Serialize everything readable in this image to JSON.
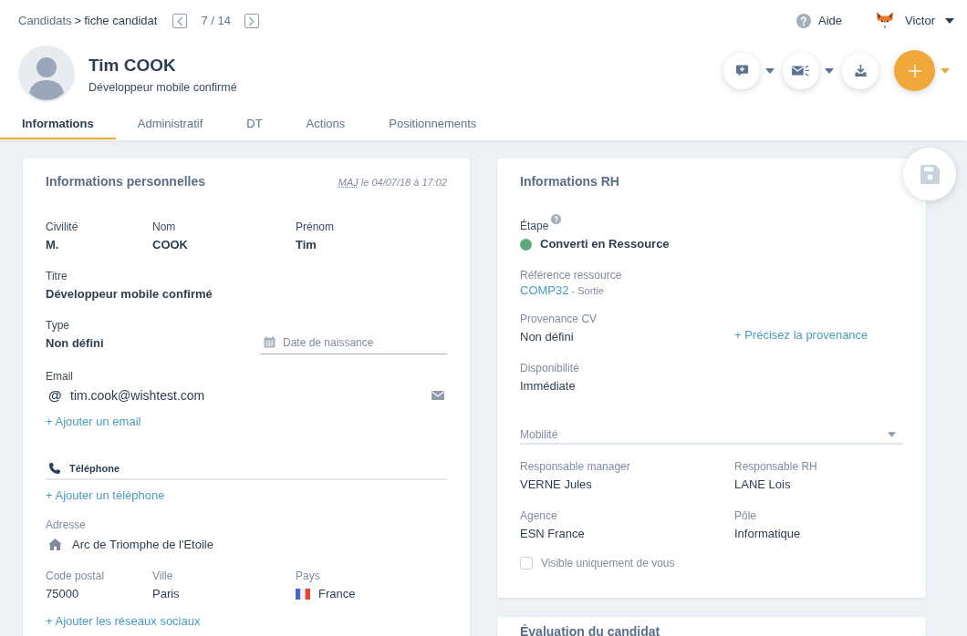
{
  "breadcrumb": {
    "items": [
      {
        "label": "Candidats",
        "current": false
      },
      {
        "label": "fiche candidat",
        "current": true
      }
    ],
    "separator": ">"
  },
  "pager": {
    "position": "7 / 14"
  },
  "help": {
    "label": "Aide"
  },
  "user": {
    "name": "Victor"
  },
  "profile": {
    "name": "Tim COOK",
    "subtitle": "Développeur mobile confirmé"
  },
  "actions": [
    {
      "kind": "comment",
      "dropdown": true
    },
    {
      "kind": "mailing",
      "dropdown": true
    },
    {
      "kind": "download",
      "dropdown": false
    },
    {
      "kind": "add",
      "dropdown": true
    }
  ],
  "tabs": [
    {
      "label": "Informations",
      "selected": true
    },
    {
      "label": "Administratif",
      "selected": false
    },
    {
      "label": "DT",
      "selected": false
    },
    {
      "label": "Actions",
      "selected": false
    },
    {
      "label": "Positionnements",
      "selected": false
    }
  ],
  "personal_card": {
    "title": "Informations personnelles",
    "updated": {
      "abbr": "MAJ",
      "text": "le 04/07/18 à 17:02"
    },
    "rows": [
      {
        "kind": "fields",
        "fields": [
          {
            "kind": "text",
            "label": "Civilité",
            "value": "M.",
            "required": true
          },
          {
            "kind": "text",
            "label": "Nom",
            "value": "COOK",
            "required": true
          },
          {
            "kind": "text",
            "label": "Prénom",
            "value": "Tim",
            "required": true
          }
        ]
      },
      {
        "kind": "fields",
        "fields": [
          {
            "kind": "text",
            "label": "Titre",
            "value": "Développeur mobile confirmé",
            "required": true
          }
        ]
      },
      {
        "kind": "field_date",
        "field": {
          "kind": "text",
          "label": "Type",
          "value": "Non défini",
          "required": true
        },
        "date": {
          "placeholder": "Date de naissance"
        }
      },
      {
        "kind": "email",
        "label": "Email",
        "required": true,
        "symbol": "@",
        "value": "tim.cook@wishtest.com",
        "add": "+ Ajouter un email"
      },
      {
        "kind": "phone",
        "title": "Téléphone",
        "add": "+ Ajouter un téléphone"
      },
      {
        "kind": "address",
        "label": "Adresse",
        "value": "Arc de Triomphe de l'Etoile"
      },
      {
        "kind": "fields",
        "fields": [
          {
            "kind": "text",
            "label": "Code postal",
            "value": "75000",
            "required": false
          },
          {
            "kind": "text",
            "label": "Ville",
            "value": "Paris",
            "required": false
          },
          {
            "kind": "country",
            "label": "Pays",
            "value": "France",
            "required": false
          }
        ]
      },
      {
        "kind": "link",
        "label": "+ Ajouter les réseaux sociaux"
      }
    ]
  },
  "hr_card": {
    "title": "Informations RH",
    "rows": [
      {
        "kind": "fields",
        "fields": [
          {
            "kind": "status",
            "label": "Étape",
            "help": true,
            "value": "Converti en Ressource",
            "color": "#5aaa7a",
            "required": true
          }
        ]
      },
      {
        "kind": "fields",
        "fields": [
          {
            "kind": "reference",
            "label": "Référence ressource",
            "value": "COMP32",
            "note": "- Sortie",
            "required": false
          }
        ]
      },
      {
        "kind": "field_link",
        "field": {
          "kind": "text",
          "label": "Provenance CV",
          "value": "Non défini",
          "required": false
        },
        "link": "+ Précisez la provenance"
      },
      {
        "kind": "fields",
        "fields": [
          {
            "kind": "text",
            "label": "Disponibilité",
            "value": "Immédiate",
            "required": false
          }
        ]
      },
      {
        "kind": "select",
        "placeholder": "Mobilité"
      },
      {
        "kind": "fields",
        "fields": [
          {
            "kind": "text",
            "label": "Responsable manager",
            "value": "VERNE Jules",
            "required": false
          },
          {
            "kind": "text",
            "label": "Responsable RH",
            "value": "LANE Lois",
            "required": false
          }
        ]
      },
      {
        "kind": "fields",
        "fields": [
          {
            "kind": "text",
            "label": "Agence",
            "value": "ESN France",
            "required": false
          },
          {
            "kind": "text",
            "label": "Pôle",
            "value": "Informatique",
            "required": false
          }
        ]
      },
      {
        "kind": "checkbox",
        "label": "Visible uniquement de vous",
        "checked": false
      }
    ]
  },
  "evaluation_card": {
    "title": "Évaluation du candidat"
  }
}
